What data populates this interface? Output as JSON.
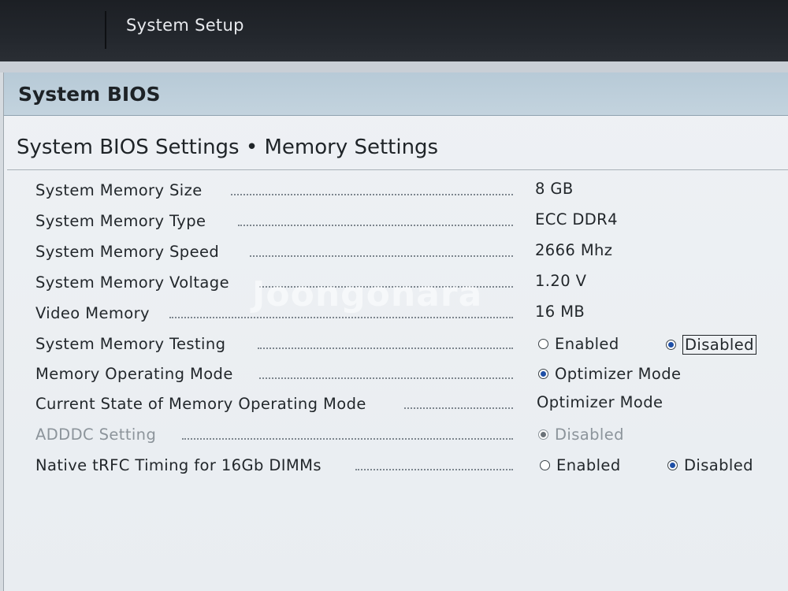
{
  "app": {
    "title": "System Setup"
  },
  "panel": {
    "title": "System BIOS"
  },
  "section": {
    "title": "System BIOS Settings • Memory Settings"
  },
  "rows": [
    {
      "label": "System Memory Size",
      "value": "8 GB"
    },
    {
      "label": "System Memory Type",
      "value": "ECC DDR4"
    },
    {
      "label": "System Memory Speed",
      "value": "2666 Mhz"
    },
    {
      "label": "System Memory Voltage",
      "value": "1.20 V"
    },
    {
      "label": "Video Memory",
      "value": "16 MB"
    },
    {
      "label": "System Memory Testing",
      "options": [
        "Enabled",
        "Disabled"
      ],
      "selected": "Disabled"
    },
    {
      "label": "Memory Operating Mode",
      "options": [
        "Optimizer Mode"
      ],
      "selected": "Optimizer Mode"
    },
    {
      "label": "Current State of Memory Operating Mode",
      "value": "Optimizer Mode"
    },
    {
      "label": "ADDDC Setting",
      "options": [
        "Disabled"
      ],
      "selected": "Disabled",
      "state": "disabled"
    },
    {
      "label": "Native tRFC Timing for 16Gb DIMMs",
      "options": [
        "Enabled",
        "Disabled"
      ],
      "selected": "Disabled"
    }
  ],
  "watermark": "Joongonara",
  "colors": {
    "header": "#b7cad7",
    "radio_selected": "#1e4fa6",
    "topbar": "#1c1f24"
  }
}
